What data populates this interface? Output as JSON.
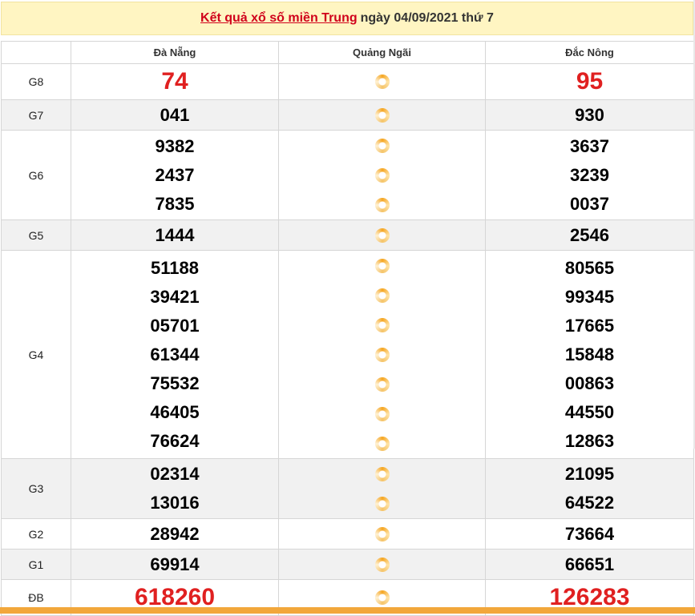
{
  "header": {
    "title_link": "Kết quả xổ số miền Trung",
    "title_rest": "ngày 04/09/2021 thứ 7"
  },
  "columns": [
    "",
    "Đà Nẵng",
    "Quảng Ngãi",
    "Đắc Nông"
  ],
  "rows": [
    {
      "label": "G8",
      "c1": [
        "74"
      ],
      "c3": [
        "95"
      ]
    },
    {
      "label": "G7",
      "c1": [
        "041"
      ],
      "c3": [
        "930"
      ]
    },
    {
      "label": "G6",
      "c1": [
        "9382",
        "2437",
        "7835"
      ],
      "c3": [
        "3637",
        "3239",
        "0037"
      ]
    },
    {
      "label": "G5",
      "c1": [
        "1444"
      ],
      "c3": [
        "2546"
      ]
    },
    {
      "label": "G4",
      "c1": [
        "51188",
        "39421",
        "05701",
        "61344",
        "75532",
        "46405",
        "76624"
      ],
      "c3": [
        "80565",
        "99345",
        "17665",
        "15848",
        "00863",
        "44550",
        "12863"
      ]
    },
    {
      "label": "G3",
      "c1": [
        "02314",
        "13016"
      ],
      "c3": [
        "21095",
        "64522"
      ]
    },
    {
      "label": "G2",
      "c1": [
        "28942"
      ],
      "c3": [
        "73664"
      ]
    },
    {
      "label": "G1",
      "c1": [
        "69914"
      ],
      "c3": [
        "66651"
      ]
    },
    {
      "label": "ĐB",
      "c1": [
        "618260"
      ],
      "c3": [
        "126283"
      ]
    }
  ],
  "colors": {
    "accent_red": "#e02020",
    "header_bg": "#fff5c2",
    "loading_orange": "#f5a623"
  },
  "icons": {
    "loading": "loading-spinner-icon"
  }
}
